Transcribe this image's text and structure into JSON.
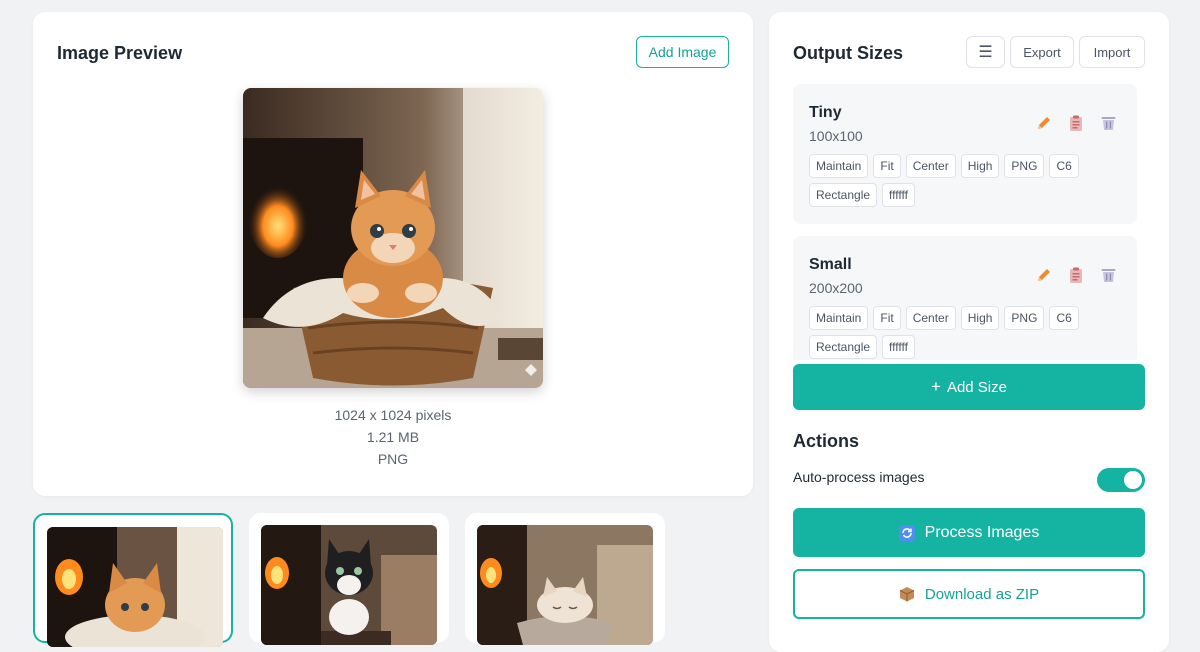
{
  "preview": {
    "title": "Image Preview",
    "add_image_label": "Add Image",
    "dimensions": "1024 x 1024 pixels",
    "file_size": "1.21 MB",
    "format": "PNG"
  },
  "thumbnails": [
    {
      "subject": "orange kitten in basket",
      "active": true
    },
    {
      "subject": "black and white kitten",
      "active": false
    },
    {
      "subject": "sleeping kitten in cup",
      "active": false
    }
  ],
  "output_sizes": {
    "title": "Output Sizes",
    "menu_icon": "hamburger-icon",
    "export_label": "Export",
    "import_label": "Import",
    "items": [
      {
        "name": "Tiny",
        "dims": "100x100",
        "tags": [
          "Maintain",
          "Fit",
          "Center",
          "High",
          "PNG",
          "C6",
          "Rectangle",
          "ffffff"
        ]
      },
      {
        "name": "Small",
        "dims": "200x200",
        "tags": [
          "Maintain",
          "Fit",
          "Center",
          "High",
          "PNG",
          "C6",
          "Rectangle",
          "ffffff"
        ]
      }
    ],
    "item_icons": [
      "pencil-icon",
      "clipboard-icon",
      "trash-icon"
    ],
    "add_size_label": "Add Size",
    "add_size_icon": "+"
  },
  "actions": {
    "title": "Actions",
    "auto_process_label": "Auto-process images",
    "auto_process_on": true,
    "process_label": "Process Images",
    "process_icon": "refresh-icon",
    "download_label": "Download as ZIP",
    "download_icon": "package-icon"
  },
  "colors": {
    "accent": "#14b3a2",
    "background": "#f1f2f4",
    "card": "#ffffff"
  }
}
